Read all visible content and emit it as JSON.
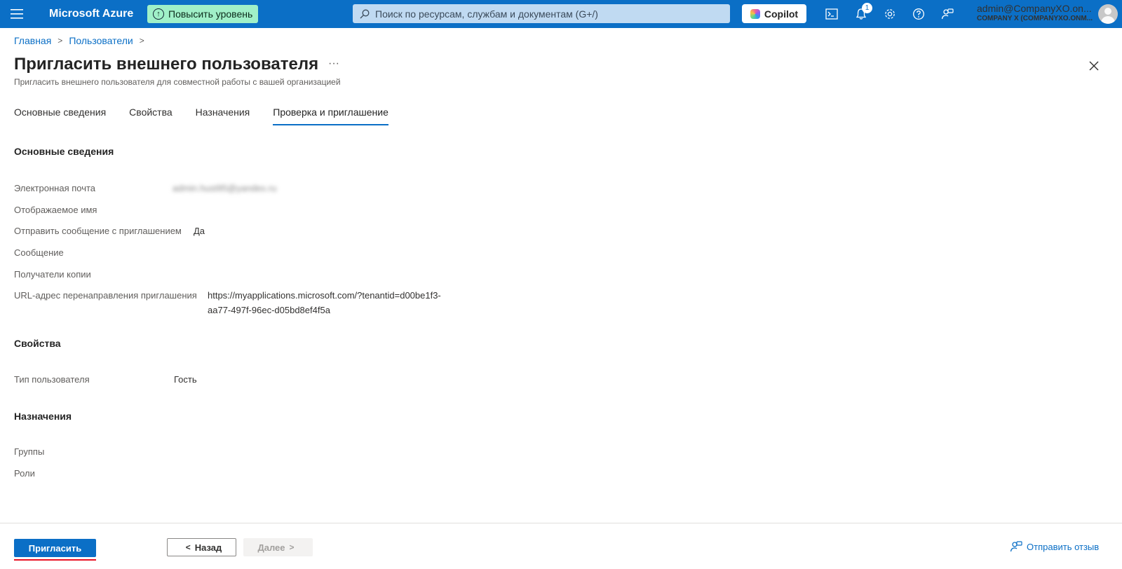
{
  "topbar": {
    "brand": "Microsoft Azure",
    "upgrade_label": "Повысить уровень",
    "search_placeholder": "Поиск по ресурсам, службам и документам (G+/)",
    "copilot_label": "Copilot",
    "notification_count": "1",
    "account_name": "admin@CompanyXO.on...",
    "account_org": "COMPANY X (COMPANYXO.ONM..."
  },
  "breadcrumb": {
    "home": "Главная",
    "users": "Пользователи"
  },
  "header": {
    "title": "Пригласить внешнего пользователя",
    "more": "···",
    "subtitle": "Пригласить внешнего пользователя для совместной работы с вашей организацией"
  },
  "tabs": [
    {
      "label": "Основные сведения"
    },
    {
      "label": "Свойства"
    },
    {
      "label": "Назначения"
    },
    {
      "label": "Проверка и приглашение"
    }
  ],
  "basics": {
    "title": "Основные сведения",
    "email_label": "Электронная почта",
    "email_value": "admin.hust95@yandex.ru",
    "display_name_label": "Отображаемое имя",
    "send_message_label": "Отправить сообщение с приглашением",
    "send_message_value": "Да",
    "message_label": "Сообщение",
    "cc_label": "Получатели копии",
    "redirect_label": "URL-адрес перенаправления приглашения",
    "redirect_value_line1": "https://myapplications.microsoft.com/?tenantid=d00be1f3-",
    "redirect_value_line2": "aa77-497f-96ec-d05bd8ef4f5a"
  },
  "properties": {
    "title": "Свойства",
    "user_type_label": "Тип пользователя",
    "user_type_value": "Гость"
  },
  "assignments": {
    "title": "Назначения",
    "groups_label": "Группы",
    "roles_label": "Роли"
  },
  "footer": {
    "invite_label": "Пригласить",
    "back_label": "Назад",
    "next_label": "Далее",
    "feedback_label": "Отправить отзыв"
  },
  "colors": {
    "topbar": "#0b6fc6",
    "accent": "#0b6fc6",
    "highlight": "#e81123"
  }
}
